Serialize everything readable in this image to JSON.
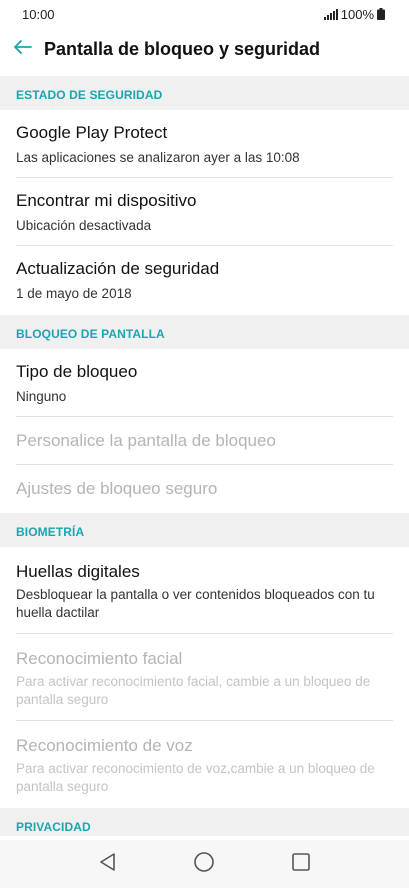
{
  "status_bar": {
    "time": "10:00",
    "battery": "100%"
  },
  "header": {
    "title": "Pantalla de bloqueo y seguridad"
  },
  "sections": {
    "security_status": {
      "header": "ESTADO DE SEGURIDAD",
      "items": [
        {
          "title": "Google Play Protect",
          "subtitle": "Las aplicaciones se analizaron ayer a las 10:08"
        },
        {
          "title": "Encontrar mi dispositivo",
          "subtitle": "Ubicación desactivada"
        },
        {
          "title": "Actualización de seguridad",
          "subtitle": "1 de mayo de 2018"
        }
      ]
    },
    "screen_lock": {
      "header": "BLOQUEO DE PANTALLA",
      "items": [
        {
          "title": "Tipo de bloqueo",
          "subtitle": "Ninguno"
        },
        {
          "title": "Personalice la pantalla de bloqueo"
        },
        {
          "title": "Ajustes de bloqueo seguro"
        }
      ]
    },
    "biometrics": {
      "header": "BIOMETRÍA",
      "items": [
        {
          "title": "Huellas digitales",
          "subtitle": "Desbloquear la pantalla o ver contenidos bloqueados con tu huella dactilar"
        },
        {
          "title": "Reconocimiento facial",
          "subtitle": "Para activar reconocimiento facial, cambie a un bloqueo de pantalla seguro"
        },
        {
          "title": "Reconocimiento de voz",
          "subtitle": "Para activar reconocimiento de voz,cambie a un bloqueo de pantalla seguro"
        }
      ]
    },
    "privacy": {
      "header": "PRIVACIDAD"
    }
  },
  "colors": {
    "accent": "#1aa5b0",
    "section_bg": "#f0f0f0",
    "disabled_text": "#b4b4b4"
  },
  "icons": {
    "back": "arrow-left-icon",
    "signal": "signal-icon",
    "battery": "battery-icon",
    "nav_back": "triangle-back-icon",
    "nav_home": "circle-home-icon",
    "nav_recents": "square-recents-icon"
  }
}
